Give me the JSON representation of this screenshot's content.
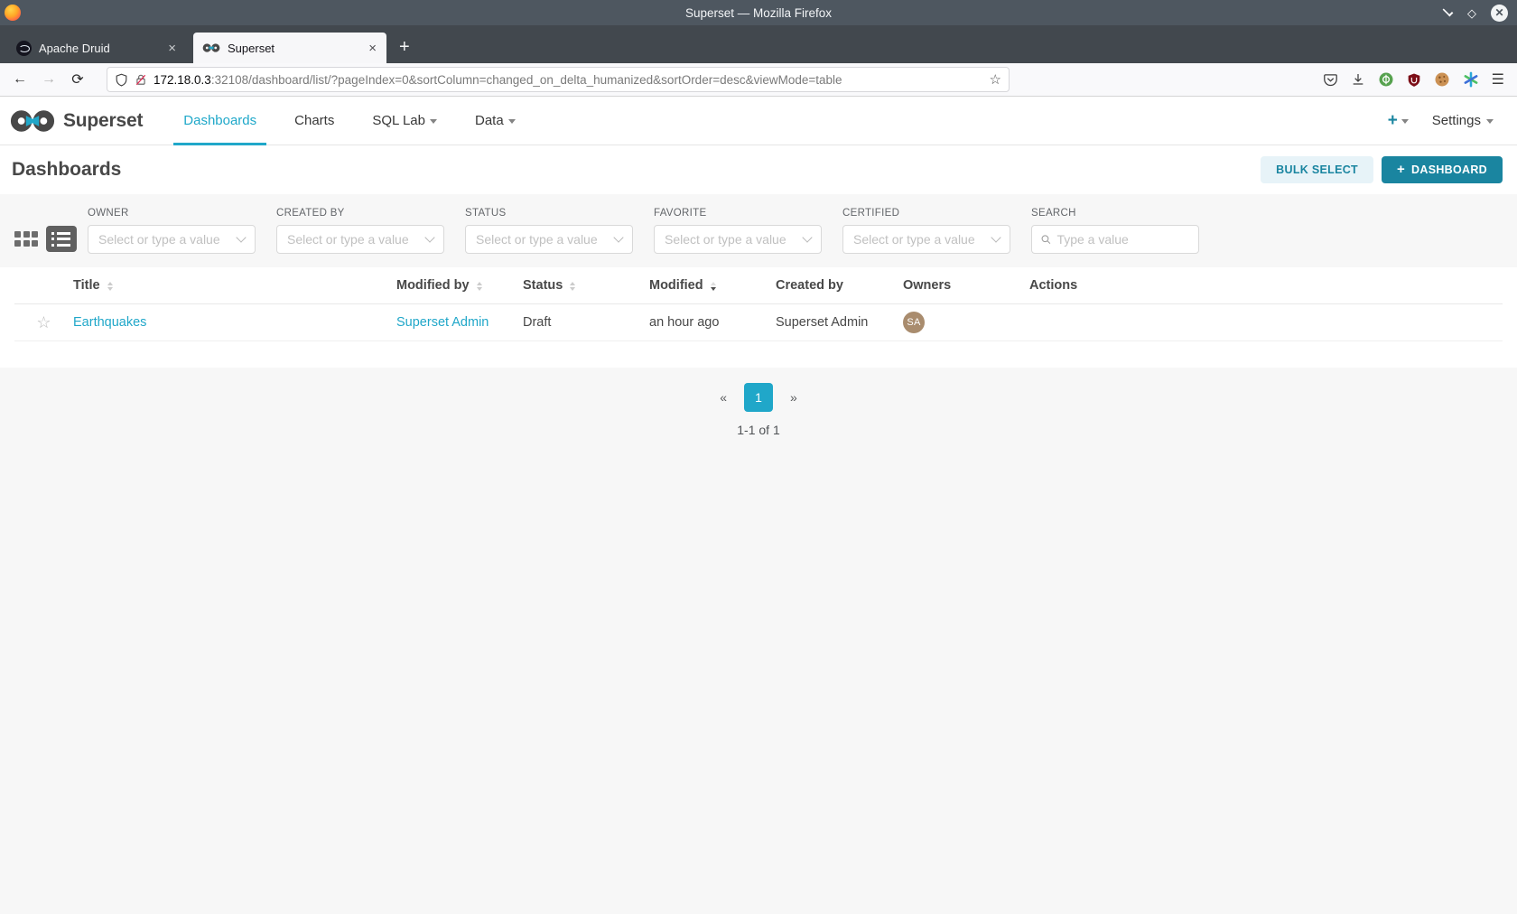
{
  "window": {
    "title": "Superset — Mozilla Firefox"
  },
  "browser": {
    "tabs": [
      {
        "label": "Apache Druid"
      },
      {
        "label": "Superset"
      }
    ],
    "url": {
      "host": "172.18.0.3",
      "rest": ":32108/dashboard/list/?pageIndex=0&sortColumn=changed_on_delta_humanized&sortOrder=desc&viewMode=table"
    }
  },
  "icons": {
    "close_tab": "×",
    "new_tab": "+",
    "back": "←",
    "forward": "→",
    "reload": "⟳",
    "bookmark_star": "☆",
    "hamburger": "☰",
    "maximize": "◇",
    "close_window": "✕",
    "row_star": "☆"
  },
  "navbar": {
    "brand": "Superset",
    "items": [
      {
        "label": "Dashboards",
        "active": true
      },
      {
        "label": "Charts"
      },
      {
        "label": "SQL Lab"
      },
      {
        "label": "Data"
      }
    ],
    "plus_label": "+",
    "settings_label": "Settings"
  },
  "page": {
    "title": "Dashboards",
    "bulk_select_label": "BULK SELECT",
    "new_dashboard_plus": "+",
    "new_dashboard_label": "DASHBOARD"
  },
  "filters": [
    {
      "label": "OWNER",
      "placeholder": "Select or type a value"
    },
    {
      "label": "CREATED BY",
      "placeholder": "Select or type a value"
    },
    {
      "label": "STATUS",
      "placeholder": "Select or type a value"
    },
    {
      "label": "FAVORITE",
      "placeholder": "Select or type a value"
    },
    {
      "label": "CERTIFIED",
      "placeholder": "Select or type a value"
    }
  ],
  "search": {
    "label": "SEARCH",
    "placeholder": "Type a value"
  },
  "table": {
    "columns": [
      "Title",
      "Modified by",
      "Status",
      "Modified",
      "Created by",
      "Owners",
      "Actions"
    ],
    "sorted_column": "Modified",
    "sort_order": "desc",
    "rows": [
      {
        "title": "Earthquakes",
        "modified_by": "Superset Admin",
        "status": "Draft",
        "modified": "an hour ago",
        "created_by": "Superset Admin",
        "owner_initials": "SA"
      }
    ]
  },
  "pagination": {
    "prev": "«",
    "page": "1",
    "next": "»",
    "summary": "1-1 of 1"
  },
  "colors": {
    "accent": "#20a7c9",
    "primary_button": "#1a85a0",
    "titlebar": "#4e5760",
    "avatar": "#a98c6e"
  }
}
